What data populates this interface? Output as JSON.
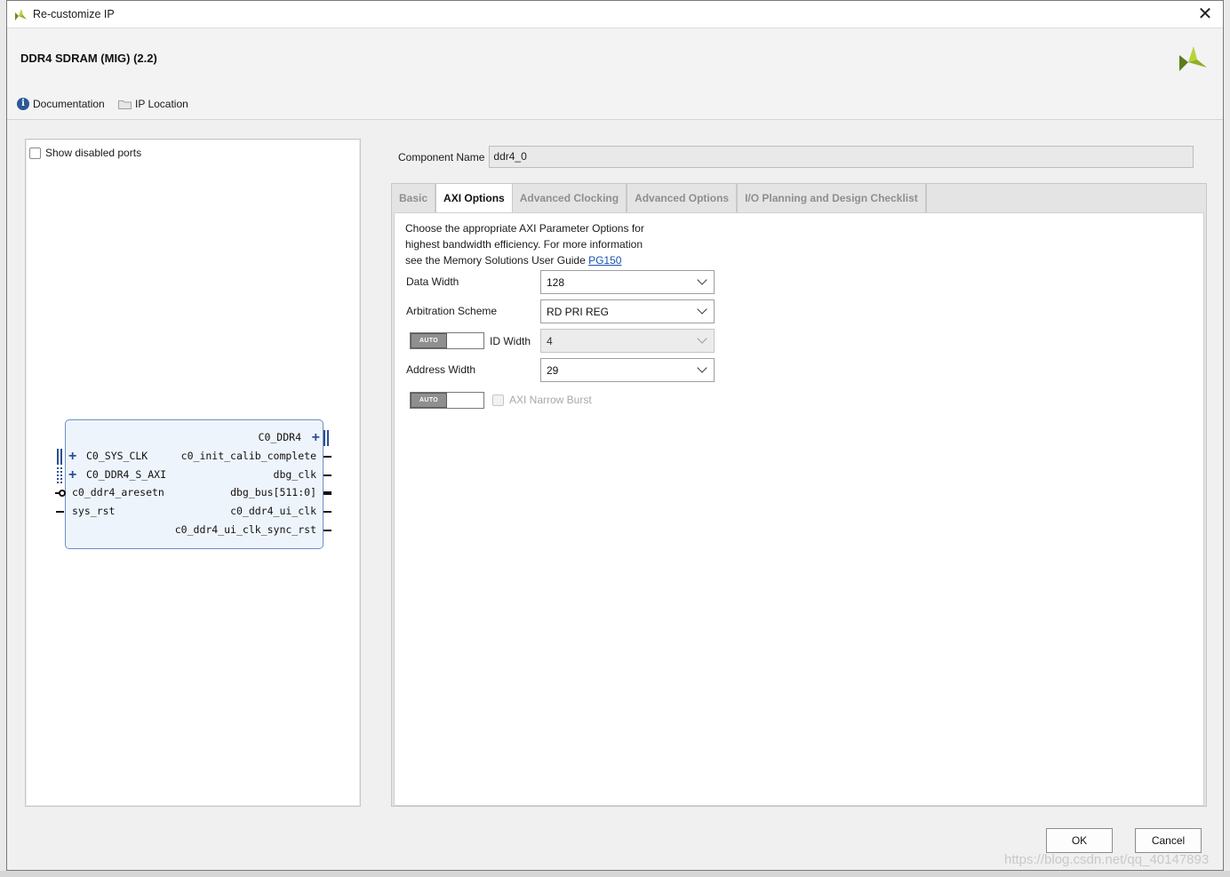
{
  "window": {
    "title": "Re-customize IP"
  },
  "header": {
    "ip_title": "DDR4 SDRAM (MIG) (2.2)",
    "doc_link": "Documentation",
    "ip_location": "IP Location"
  },
  "left_panel": {
    "show_disabled_label": "Show disabled ports",
    "block": {
      "right_bus": "C0_DDR4",
      "left_ports": [
        "C0_SYS_CLK",
        "C0_DDR4_S_AXI",
        "c0_ddr4_aresetn",
        "sys_rst"
      ],
      "right_ports": [
        "c0_init_calib_complete",
        "dbg_clk",
        "dbg_bus[511:0]",
        "c0_ddr4_ui_clk",
        "c0_ddr4_ui_clk_sync_rst"
      ]
    }
  },
  "component": {
    "label": "Component Name",
    "value": "ddr4_0"
  },
  "tabs": [
    "Basic",
    "AXI Options",
    "Advanced Clocking",
    "Advanced Options",
    "I/O Planning and Design Checklist"
  ],
  "axi": {
    "desc_lines": [
      "Choose the appropriate AXI Parameter Options for",
      "highest bandwidth efficiency. For more information",
      "see the Memory Solutions User Guide "
    ],
    "link": "PG150",
    "data_width_label": "Data Width",
    "data_width": "128",
    "arb_label": "Arbitration Scheme",
    "arb": "RD PRI REG",
    "id_width_label": "ID Width",
    "id_width": "4",
    "addr_width_label": "Address Width",
    "addr_width": "29",
    "auto": "AUTO",
    "narrow_label": "AXI Narrow Burst"
  },
  "buttons": {
    "ok": "OK",
    "cancel": "Cancel"
  },
  "watermark": "https://blog.csdn.net/qq_40147893"
}
